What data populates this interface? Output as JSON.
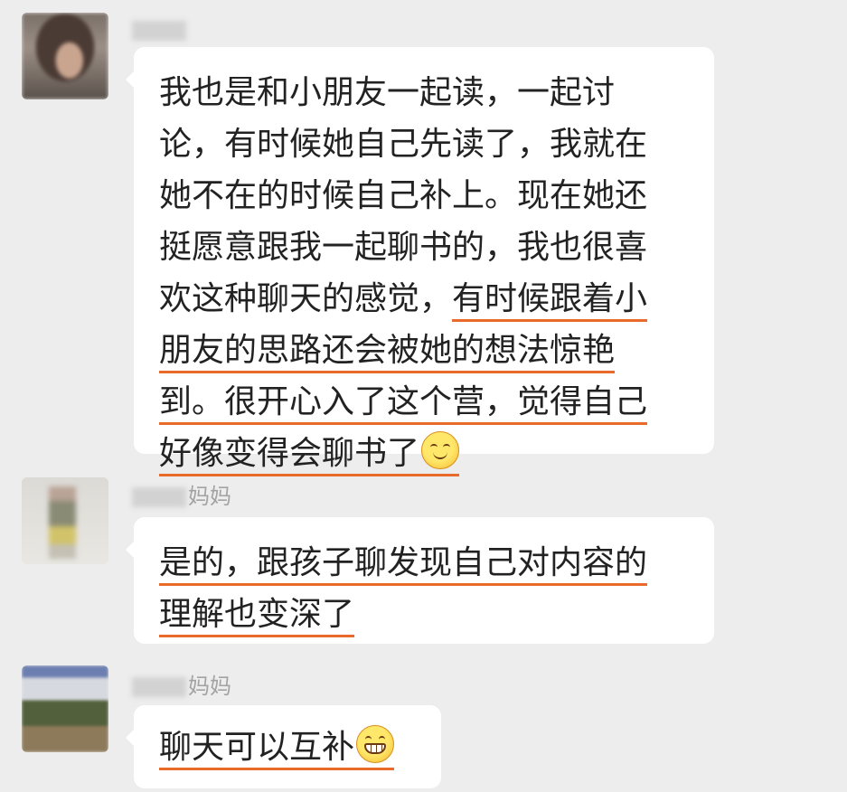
{
  "messages": [
    {
      "sender": "",
      "lines": [
        {
          "pre": "我也是和小朋友一起读，一起讨",
          "u": ""
        },
        {
          "pre": "论，有时候她自己先读了，我就在",
          "u": ""
        },
        {
          "pre": "她不在的时候自己补上。现在她还",
          "u": ""
        },
        {
          "pre": "挺愿意跟我一起聊书的，我也很喜",
          "u": ""
        },
        {
          "pre": "欢这种聊天的感觉，",
          "u": "有时候跟着小"
        },
        {
          "pre": "",
          "u": "朋友的思路还会被她的想法惊艳"
        },
        {
          "pre": "",
          "u": "到。很开心入了这个营，觉得自己"
        },
        {
          "pre": "",
          "u": "好像变得会聊书了"
        }
      ],
      "emoji": "smiling-face-emoji"
    },
    {
      "sender": "妈妈",
      "lines": [
        {
          "pre": "",
          "u": "是的，跟孩子聊发现自己对内容的"
        },
        {
          "pre": "",
          "u": "理解也变深了"
        }
      ]
    },
    {
      "sender": "妈妈",
      "lines": [
        {
          "pre": "",
          "u": "聊天可以互补"
        }
      ],
      "emoji": "grinning-face-emoji"
    }
  ],
  "colors": {
    "background": "#ededed",
    "bubble": "#ffffff",
    "underline": "#ea6a2c",
    "text": "#222222",
    "name": "#a3a3a3"
  }
}
